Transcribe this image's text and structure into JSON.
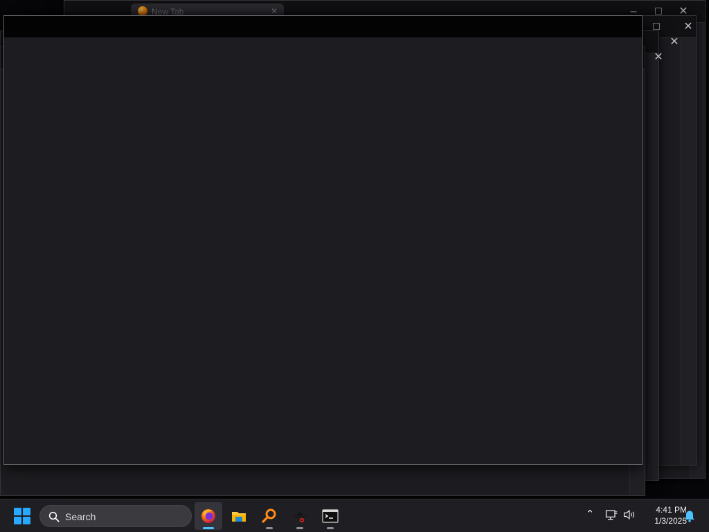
{
  "browser_tab": {
    "label": "New Tab"
  },
  "window_controls": {
    "maximize_glyph": "□",
    "close_glyph": "✕",
    "minimize_glyph": "–",
    "menu_glyph": "≡"
  },
  "taskbar": {
    "search_label": "Search",
    "apps": [
      {
        "name": "firefox",
        "icon": "firefox-icon"
      },
      {
        "name": "file-explorer",
        "icon": "folder-icon"
      },
      {
        "name": "search-tool",
        "icon": "magnifier-icon"
      },
      {
        "name": "hacker-app",
        "icon": "hat-icon"
      },
      {
        "name": "terminal",
        "icon": "terminal-icon"
      }
    ],
    "time": "4:41 PM",
    "date": "1/3/2025"
  },
  "theme": {
    "accent": "#4cc2ff",
    "taskbar_bg": "#1f1f23",
    "window_bg": "#1d1c21",
    "titlebar_bg": "#030303"
  }
}
